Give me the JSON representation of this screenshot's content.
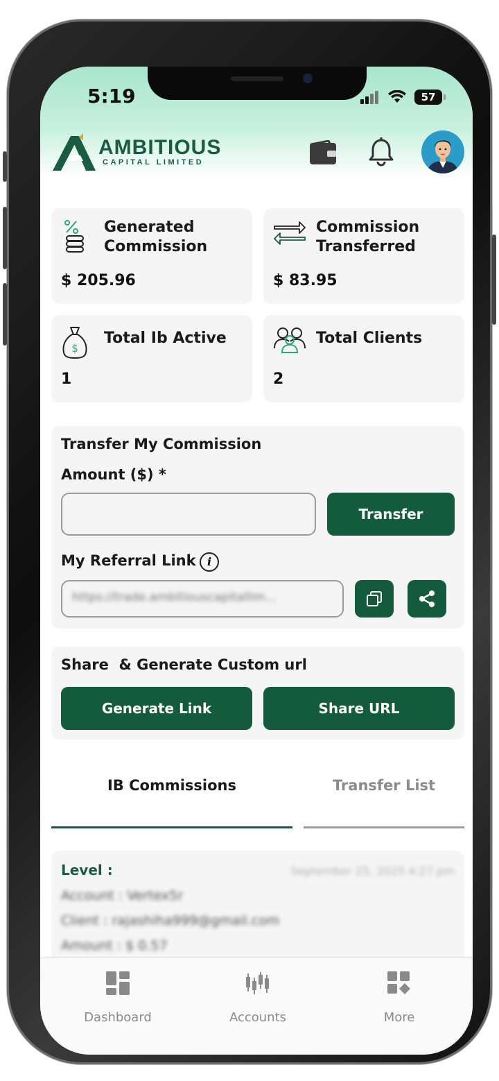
{
  "status_bar": {
    "time": "5:19",
    "battery": "57"
  },
  "brand": {
    "name": "AMBITIOUS",
    "subtitle": "CAPITAL LIMITED"
  },
  "stats": [
    {
      "title_line1": "Generated",
      "title_line2": "Commission",
      "value": "$ 205.96"
    },
    {
      "title_line1": "Commission",
      "title_line2": "Transferred",
      "value": "$ 83.95"
    },
    {
      "title_line1": "Total Ib Active",
      "title_line2": "",
      "value": "1"
    },
    {
      "title_line1": "Total Clients",
      "title_line2": "",
      "value": "2"
    }
  ],
  "transfer": {
    "title": "Transfer My Commission",
    "amount_label": "Amount ($) *",
    "amount_value": "",
    "transfer_button": "Transfer",
    "referral_label": "My Referral Link",
    "info_glyph": "i",
    "referral_link": "https://trade.ambitiouscapitallim..."
  },
  "custom_url": {
    "title": "Share  & Generate Custom url",
    "generate_button": "Generate Link",
    "share_button": "Share URL"
  },
  "tabs": [
    {
      "label": "IB Commissions",
      "active": true
    },
    {
      "label": "Transfer List",
      "active": false
    }
  ],
  "commission_item": {
    "level_label": "Level :",
    "date": "September 25, 2025 4:27 pm",
    "account": "Account : Vertex5r",
    "client": "Client : rajashiha999@gmail.com",
    "amount": "Amount : $ 0.57"
  },
  "bottom_nav": [
    {
      "label": "Dashboard"
    },
    {
      "label": "Accounts"
    },
    {
      "label": "More"
    }
  ],
  "colors": {
    "brand_green": "#145a3c",
    "header_mint": "#a8e6cd",
    "accent_teal": "#2aa876"
  }
}
